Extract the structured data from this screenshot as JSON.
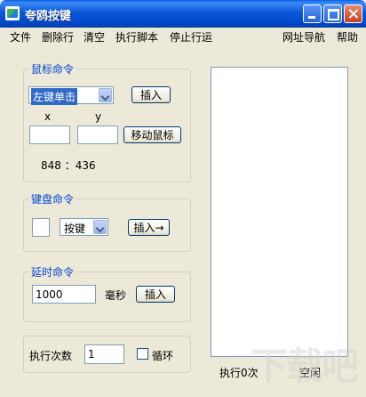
{
  "window": {
    "title": "夸鸥按键"
  },
  "menu": {
    "file": "文件",
    "delete_row": "删除行",
    "clear": "清空",
    "run_script": "执行脚本",
    "stop_run": "停止行运",
    "web_nav": "网址导航",
    "help": "帮助"
  },
  "mouse": {
    "title": "鼠标命令",
    "action_selected": "左键单击",
    "insert_label": "插入",
    "x_label": "x",
    "y_label": "y",
    "x_value": "",
    "y_value": "",
    "move_label": "移动鼠标",
    "coords": "848 ：436"
  },
  "keyboard": {
    "title": "键盘命令",
    "key_value": "",
    "mode_selected": "按键",
    "insert_label": "插入→"
  },
  "delay": {
    "title": "延时命令",
    "value": "1000",
    "unit": "毫秒",
    "insert_label": "插入"
  },
  "exec": {
    "count_label": "执行次数",
    "count_value": "1",
    "loop_label": "循环",
    "loop_checked": false
  },
  "status": {
    "run_count": "执行0次",
    "state": "空闲"
  },
  "watermark": "下载吧"
}
